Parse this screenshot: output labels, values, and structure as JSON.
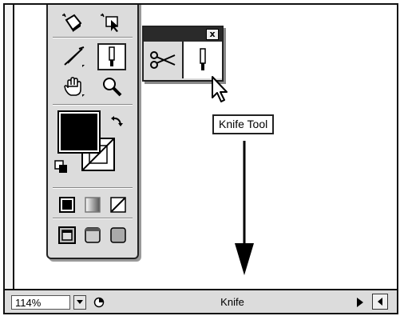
{
  "toolbox": {
    "tools": [
      {
        "name": "live-paint-bucket-icon"
      },
      {
        "name": "live-paint-selection-icon"
      },
      {
        "name": "scissors-icon"
      },
      {
        "name": "knife-icon"
      },
      {
        "name": "hand-icon"
      },
      {
        "name": "zoom-icon"
      },
      {
        "name": "fill-swatch"
      },
      {
        "name": "stroke-swatch"
      },
      {
        "name": "swap-fill-stroke-icon"
      },
      {
        "name": "default-fill-stroke-icon"
      },
      {
        "name": "color-mode-icon"
      },
      {
        "name": "gradient-mode-icon"
      },
      {
        "name": "none-mode-icon"
      },
      {
        "name": "normal-screen-mode-icon"
      },
      {
        "name": "full-screen-menu-mode-icon"
      },
      {
        "name": "full-screen-mode-icon"
      }
    ],
    "colors": {
      "fill": "#000000",
      "stroke": "#ffffff"
    }
  },
  "flyout": {
    "close_label": "x",
    "tools": [
      {
        "name": "scissors-icon"
      },
      {
        "name": "knife-icon",
        "selected": true
      }
    ]
  },
  "tooltip": {
    "text": "Knife Tool"
  },
  "status_bar": {
    "zoom": "114%",
    "label": "Knife"
  }
}
